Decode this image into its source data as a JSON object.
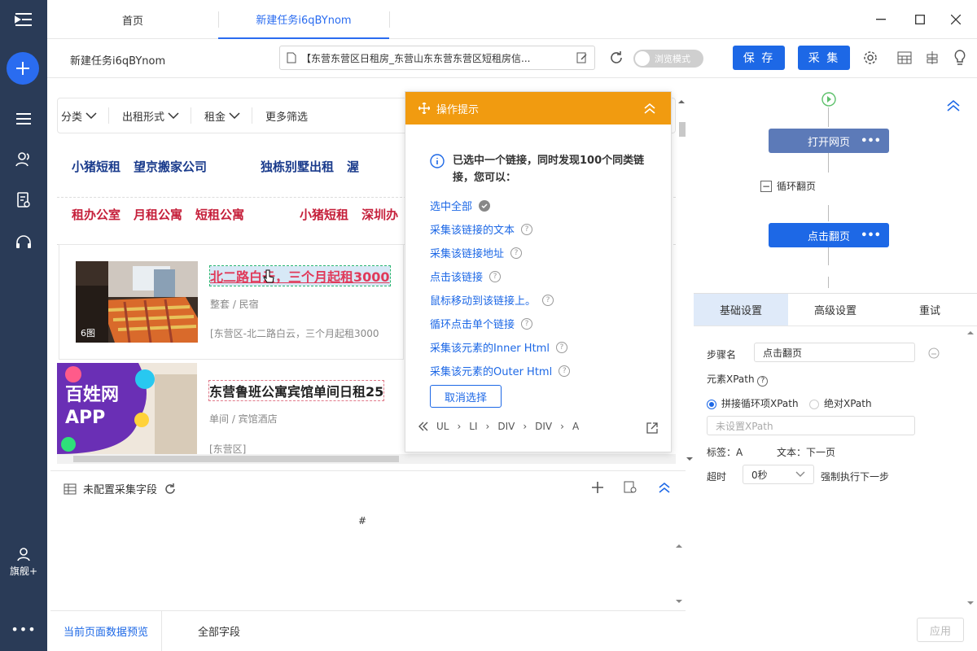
{
  "rail": {
    "flag_label": "旗舰+",
    "more_label": "•••"
  },
  "tabs": [
    {
      "label": "首页"
    },
    {
      "label": "新建任务i6qBYnom"
    }
  ],
  "toolbar": {
    "task_name": "新建任务i6qBYnom",
    "url_text": "【东营东营区日租房_东营山东东营东营区短租房信...",
    "toggle_label": "浏览模式",
    "save_label": "保 存",
    "collect_label": "采 集"
  },
  "page": {
    "filters": [
      "分类",
      "出租形式",
      "租金",
      "更多筛选"
    ],
    "links_row1": [
      "小猪短租",
      "望京搬家公司",
      "独栋别墅出租",
      "渥"
    ],
    "links_row2": [
      "租办公室",
      "月租公寓",
      "短租公寓",
      "小猪短租",
      "深圳办"
    ],
    "listings": [
      {
        "title": "北二路白云，三个月起租3000",
        "type": "整套 / 民宿",
        "addr": "[东营区-北二路白云，三个月起租3000",
        "photos": "6图"
      },
      {
        "title": "东营鲁班公寓宾馆单间日租25",
        "type": "单间 / 宾馆酒店",
        "addr": "[东营区]",
        "ad_line1": "百姓网",
        "ad_line2": "APP"
      }
    ]
  },
  "hint": {
    "title": "操作提示",
    "message": "已选中一个链接，同时发现100个同类链接，您可以：",
    "actions": [
      "选中全部",
      "采集该链接的文本",
      "采集该链接地址",
      "点击该链接",
      "鼠标移动到该链接上。",
      "循环点击单个链接",
      "采集该元素的Inner Html",
      "采集该元素的Outer Html"
    ],
    "cancel_label": "取消选择",
    "crumbs": [
      "UL",
      "LI",
      "DIV",
      "DIV",
      "A"
    ]
  },
  "data_preview": {
    "header": "未配置采集字段",
    "col_marker": "#",
    "tabs": [
      "当前页面数据预览",
      "全部字段"
    ]
  },
  "workflow": {
    "nodes": [
      "打开网页",
      "循环翻页",
      "点击翻页"
    ]
  },
  "settings": {
    "tabs": [
      "基础设置",
      "高级设置",
      "重试"
    ],
    "step_name_label": "步骤名",
    "step_name_value": "点击翻页",
    "xpath_label": "元素XPath",
    "radio_concat": "拼接循环项XPath",
    "radio_absolute": "绝对XPath",
    "xpath_placeholder": "未设置XPath",
    "tag_label": "标签：",
    "tag_value": "A",
    "text_label": "文本：",
    "text_value": "下一页",
    "timeout_label": "超时",
    "timeout_value": "0秒",
    "force_next_label": "强制执行下一步",
    "apply_label": "应用"
  }
}
